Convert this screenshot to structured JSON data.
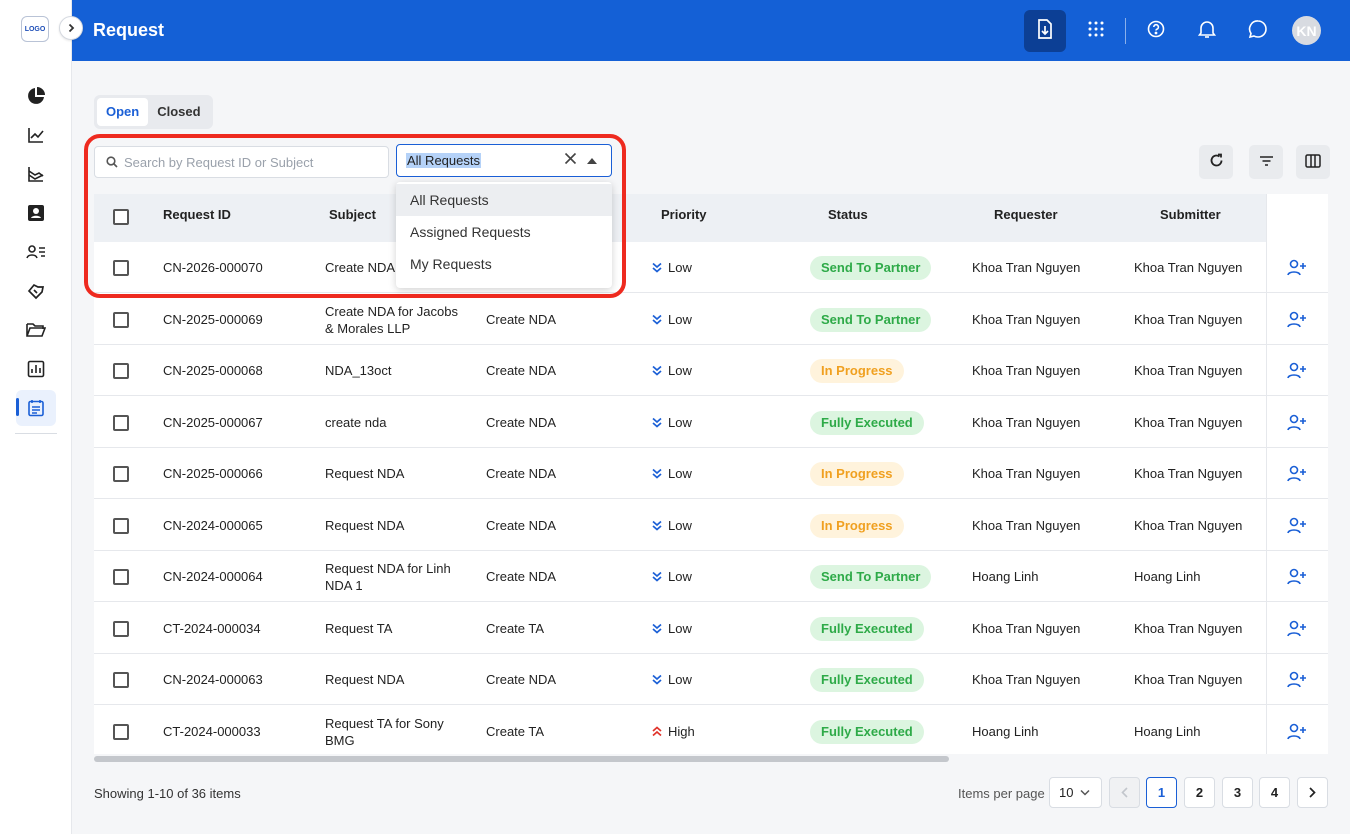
{
  "app": {
    "logo_text": "LOGO",
    "page_title": "Request",
    "avatar_initials": "KN"
  },
  "tabs": [
    {
      "label": "Open",
      "active": true
    },
    {
      "label": "Closed",
      "active": false
    }
  ],
  "search": {
    "placeholder": "Search by Request ID or Subject",
    "value": ""
  },
  "filter_select": {
    "selected": "All Requests",
    "options": [
      "All Requests",
      "Assigned Requests",
      "My Requests"
    ]
  },
  "columns": {
    "request_id": "Request ID",
    "subject": "Subject",
    "priority": "Priority",
    "status": "Status",
    "requester": "Requester",
    "submitter": "Submitter"
  },
  "rows": [
    {
      "id": "CN-2026-000070",
      "subject": "Create NDA",
      "type": "",
      "priority": "Low",
      "status": "Send To Partner",
      "requester": "Khoa Tran Nguyen",
      "submitter": "Khoa Tran Nguyen"
    },
    {
      "id": "CN-2025-000069",
      "subject": "Create NDA for Jacobs & Morales LLP",
      "type": "Create NDA",
      "priority": "Low",
      "status": "Send To Partner",
      "requester": "Khoa Tran Nguyen",
      "submitter": "Khoa Tran Nguyen"
    },
    {
      "id": "CN-2025-000068",
      "subject": "NDA_13oct",
      "type": "Create NDA",
      "priority": "Low",
      "status": "In Progress",
      "requester": "Khoa Tran Nguyen",
      "submitter": "Khoa Tran Nguyen"
    },
    {
      "id": "CN-2025-000067",
      "subject": "create nda",
      "type": "Create NDA",
      "priority": "Low",
      "status": "Fully Executed",
      "requester": "Khoa Tran Nguyen",
      "submitter": "Khoa Tran Nguyen"
    },
    {
      "id": "CN-2025-000066",
      "subject": "Request NDA",
      "type": "Create NDA",
      "priority": "Low",
      "status": "In Progress",
      "requester": "Khoa Tran Nguyen",
      "submitter": "Khoa Tran Nguyen"
    },
    {
      "id": "CN-2024-000065",
      "subject": "Request NDA",
      "type": "Create NDA",
      "priority": "Low",
      "status": "In Progress",
      "requester": "Khoa Tran Nguyen",
      "submitter": "Khoa Tran Nguyen"
    },
    {
      "id": "CN-2024-000064",
      "subject": "Request NDA for Linh NDA 1",
      "type": "Create NDA",
      "priority": "Low",
      "status": "Send To Partner",
      "requester": "Hoang Linh",
      "submitter": "Hoang Linh"
    },
    {
      "id": "CT-2024-000034",
      "subject": "Request TA",
      "type": "Create TA",
      "priority": "Low",
      "status": "Fully Executed",
      "requester": "Khoa Tran Nguyen",
      "submitter": "Khoa Tran Nguyen"
    },
    {
      "id": "CN-2024-000063",
      "subject": "Request NDA",
      "type": "Create NDA",
      "priority": "Low",
      "status": "Fully Executed",
      "requester": "Khoa Tran Nguyen",
      "submitter": "Khoa Tran Nguyen"
    },
    {
      "id": "CT-2024-000033",
      "subject": "Request TA for Sony BMG",
      "type": "Create TA",
      "priority": "High",
      "status": "Fully Executed",
      "requester": "Hoang Linh",
      "submitter": "Hoang Linh"
    }
  ],
  "status_colors": {
    "Send To Partner": {
      "bg": "#dcf5e0",
      "fg": "#2eaa48"
    },
    "In Progress": {
      "bg": "#fff3dc",
      "fg": "#f0a020"
    },
    "Fully Executed": {
      "bg": "#dcf5e0",
      "fg": "#2eaa48"
    }
  },
  "priority_colors": {
    "Low": "#1a5fd6",
    "High": "#e0322a"
  },
  "pagination": {
    "showing": "Showing 1-10 of 36 items",
    "per_page_label": "Items per page",
    "per_page": "10",
    "pages": [
      "1",
      "2",
      "3",
      "4"
    ],
    "current": "1"
  },
  "colors": {
    "header_bg": "#1460d6",
    "accent": "#1a5fd6"
  }
}
